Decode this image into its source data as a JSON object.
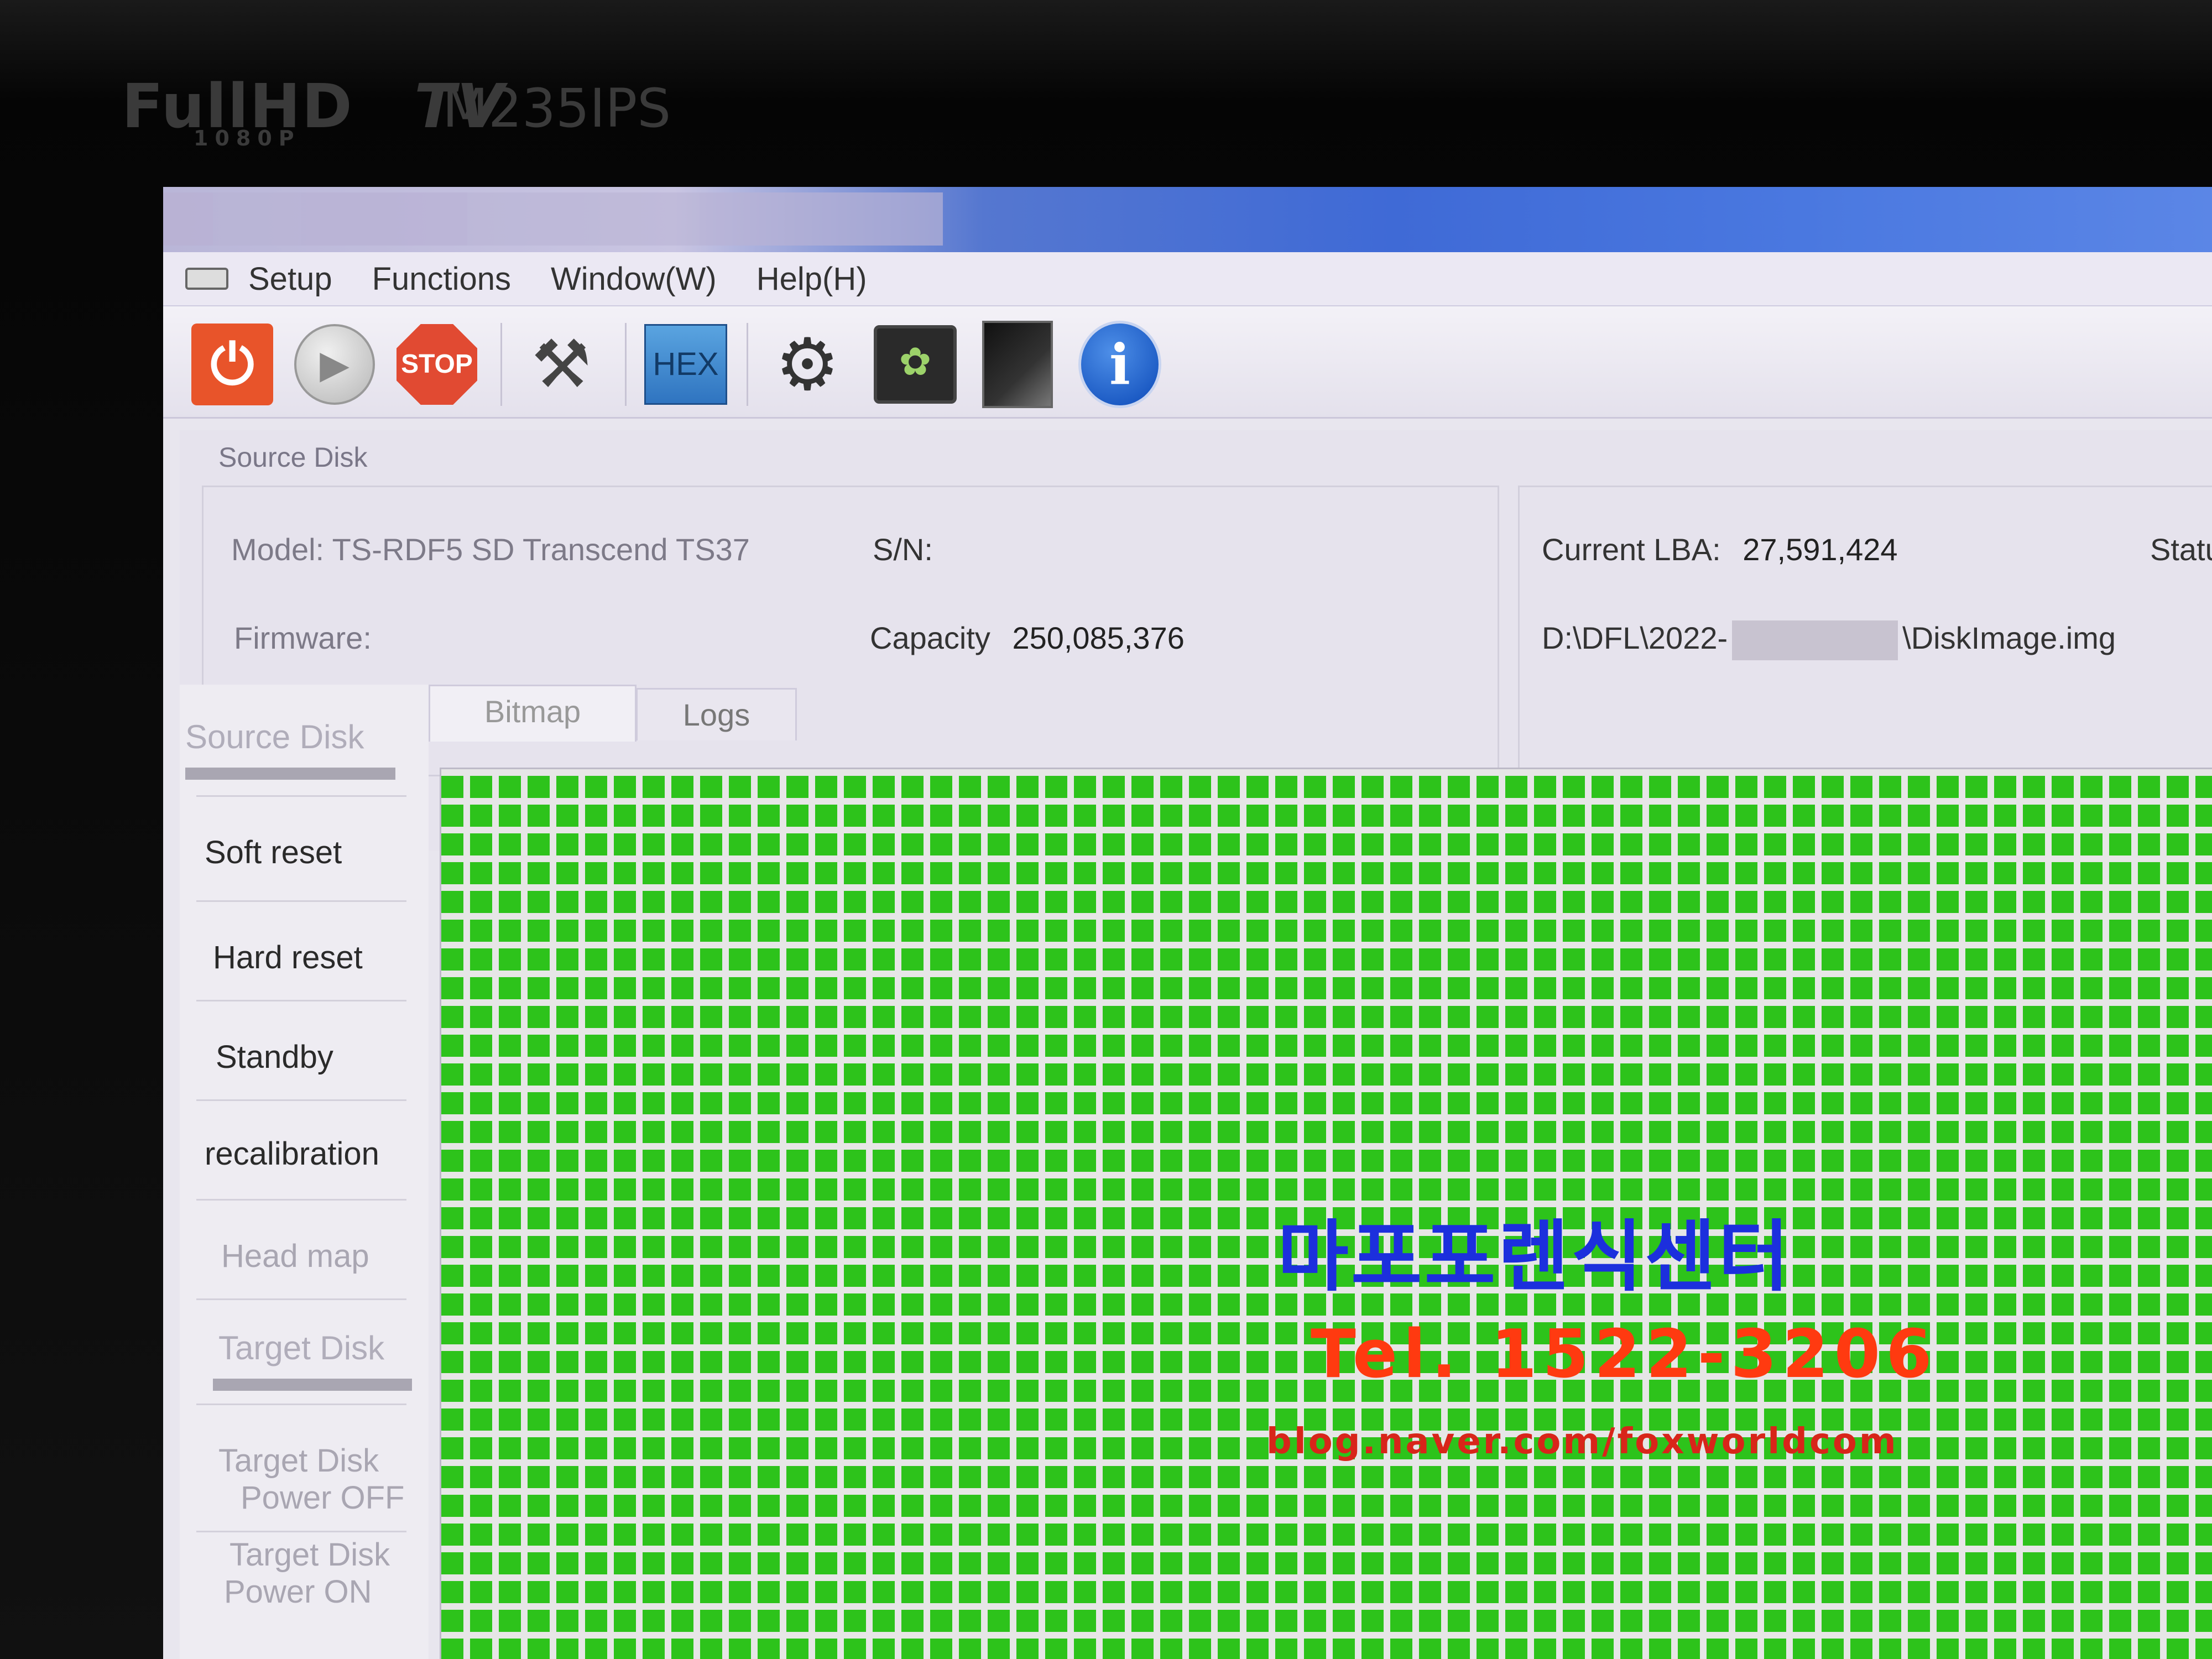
{
  "bezel": {
    "brand": "FullHD",
    "brand_sub": "1080P",
    "tv": "TV",
    "model": "M235IPS"
  },
  "menu": {
    "items": [
      "Setup",
      "Functions",
      "Window(W)",
      "Help(H)"
    ]
  },
  "toolbar": {
    "stop_label": "STOP",
    "hex_label": "HEX",
    "info_label": "i"
  },
  "source_disk": {
    "group_label": "Source Disk",
    "model_label": "Model:",
    "model_value": "TS-RDF5 SD  Transcend   TS37",
    "sn_label": "S/N:",
    "sn_value": "",
    "firmware_label": "Firmware:",
    "firmware_value": "",
    "capacity_label": "Capacity",
    "capacity_value": "250,085,376",
    "current_lba_label": "Current LBA:",
    "current_lba_value": "27,591,424",
    "status_label": "Statu",
    "image_path_prefix": "D:\\DFL\\2022-",
    "image_path_suffix": "\\DiskImage.img"
  },
  "left_panel": {
    "source_heading": "Source Disk",
    "buttons": [
      "Soft reset",
      "Hard reset",
      "Standby",
      "recalibration"
    ],
    "head_map": "Head map",
    "target_heading": "Target Disk",
    "target_power_off_1": "Target Disk",
    "target_power_off_2": "Power OFF",
    "target_power_on_1": "Target Disk",
    "target_power_on_2": "Power ON"
  },
  "tabs": [
    "Bitmap",
    "Logs"
  ],
  "bitmap": {
    "block_color": "#2dc31b",
    "state": "all-read"
  },
  "watermark": {
    "name": "마포포렌식센터",
    "tel": "Tel. 1522-3206",
    "blog": "blog.naver.com/foxworldcom"
  },
  "colors": {
    "power": "#e8542a",
    "stop": "#e14a32",
    "hex": "#2f74c0",
    "info": "#0b49b8"
  }
}
